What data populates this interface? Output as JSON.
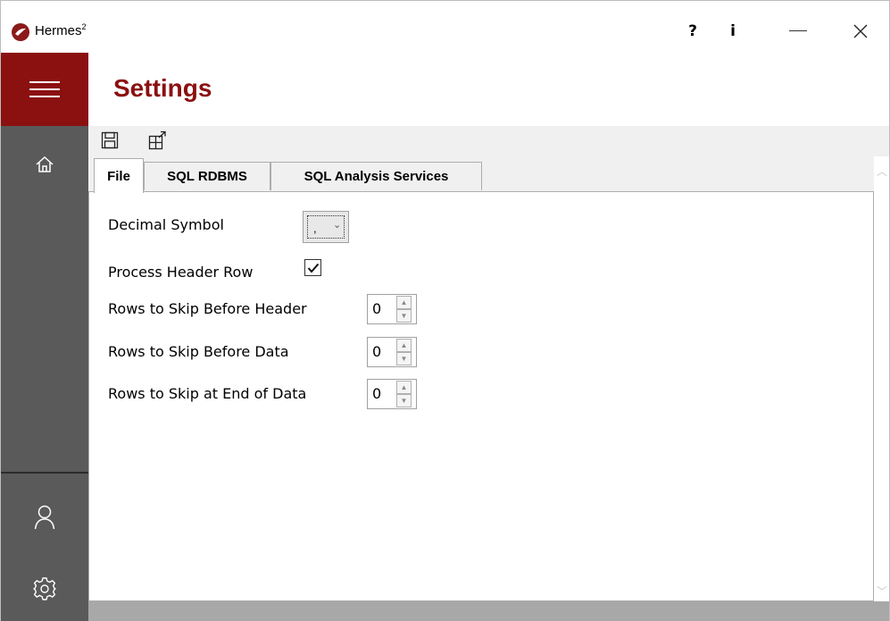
{
  "window": {
    "app_name": "Hermes",
    "app_superscript": "2",
    "help_label": "?",
    "info_label": "i",
    "minimize_label": "—",
    "close_label": "✕"
  },
  "page": {
    "title": "Settings"
  },
  "tabs": [
    {
      "label": "File",
      "active": true
    },
    {
      "label": "SQL RDBMS",
      "active": false
    },
    {
      "label": "SQL Analysis Services",
      "active": false
    }
  ],
  "form": {
    "decimal_symbol": {
      "label": "Decimal Symbol",
      "value": ","
    },
    "process_header_row": {
      "label": "Process Header Row",
      "checked": true
    },
    "rows_skip_before_header": {
      "label": "Rows to Skip Before Header",
      "value": "0"
    },
    "rows_skip_before_data": {
      "label": "Rows to Skip Before Data",
      "value": "0"
    },
    "rows_skip_end_of_data": {
      "label": "Rows to Skip at End of Data",
      "value": "0"
    }
  },
  "colors": {
    "accent": "#8b1010",
    "sidebar": "#5a5a5a"
  },
  "icons": [
    "hermes-logo-icon",
    "hamburger-menu-icon",
    "home-icon",
    "user-icon",
    "settings-gear-icon",
    "save-icon",
    "export-icon"
  ]
}
